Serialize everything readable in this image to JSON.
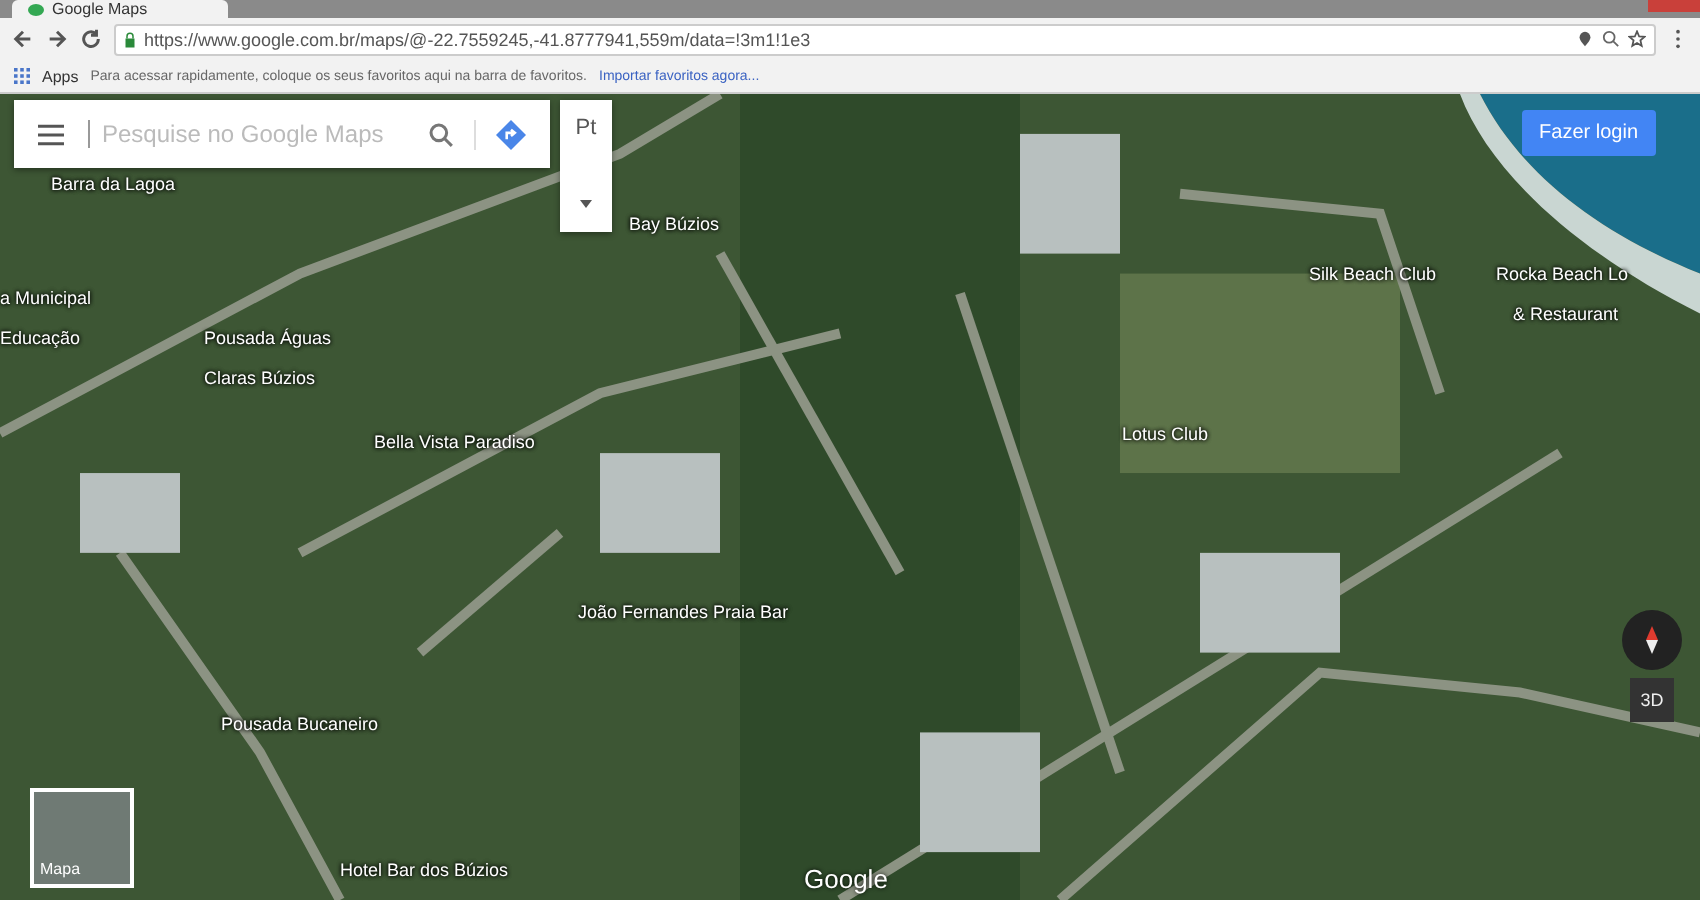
{
  "browser": {
    "tab_title": "Google Maps",
    "url": "https://www.google.com.br/maps/@-22.7559245,-41.8777941,559m/data=!3m1!1e3",
    "bookmarks_bar": {
      "apps": "Apps",
      "hint": "Para acessar rapidamente, coloque os seus favoritos aqui na barra de favoritos.",
      "import_link": "Importar favoritos agora..."
    }
  },
  "maps": {
    "search": {
      "placeholder": "Pesquise no Google Maps"
    },
    "language_button": "Pt",
    "login_button": "Fazer login",
    "layer_switch": {
      "label": "Mapa",
      "selected": false
    },
    "view_3d": "3D",
    "logo": "Google",
    "places": [
      {
        "name": "Barra da Lagoa"
      },
      {
        "name": "a Municipal"
      },
      {
        "name": "Educação"
      },
      {
        "name": "Bay Búzios"
      },
      {
        "name": "Pousada Águas"
      },
      {
        "name": "Claras Búzios"
      },
      {
        "name": "Bella Vista Paradiso"
      },
      {
        "name": "Silk Beach Club"
      },
      {
        "name": "Rocka Beach Lo"
      },
      {
        "name": "& Restaurant"
      },
      {
        "name": "Lotus Club"
      },
      {
        "name": "João Fernandes Praia Bar"
      },
      {
        "name": "Pousada Bucaneiro"
      },
      {
        "name": "Hotel Bar dos Búzios"
      }
    ]
  }
}
